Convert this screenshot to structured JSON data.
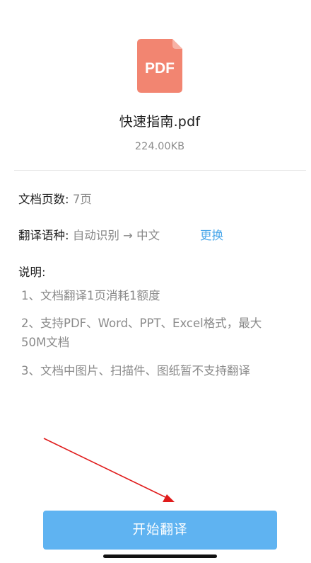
{
  "file": {
    "icon_text": "PDF",
    "icon_color": "#f28571",
    "name": "快速指南.pdf",
    "size": "224.00KB"
  },
  "info": {
    "pages_label": "文档页数:",
    "pages_value": "7页",
    "lang_label": "翻译语种:",
    "lang_value": "自动识别 → 中文",
    "change_label": "更换"
  },
  "notes": {
    "title": "说明:",
    "items": [
      "1、文档翻译1页消耗1额度",
      "2、支持PDF、Word、PPT、Excel格式，最大50M文档",
      "3、文档中图片、扫描件、图纸暂不支持翻译"
    ]
  },
  "action": {
    "start_label": "开始翻译",
    "button_color": "#5fb3f1"
  },
  "annotation": {
    "arrow_color": "#e01b1b"
  }
}
